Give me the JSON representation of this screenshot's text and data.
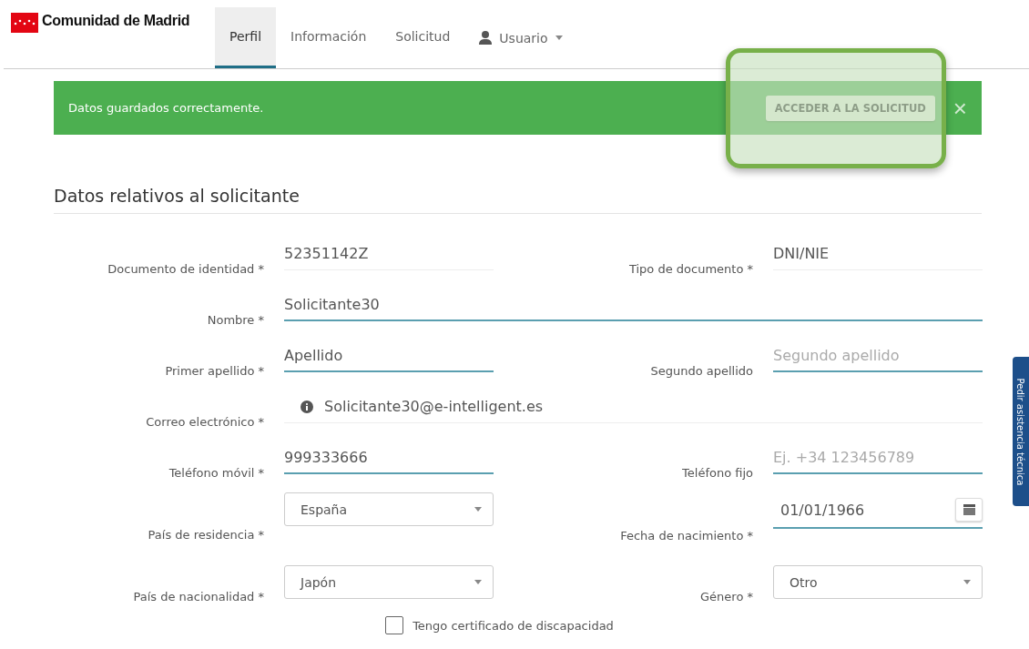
{
  "header": {
    "logo": "Comunidad de Madrid",
    "tabs": [
      {
        "label": "Perfil",
        "selected": true
      },
      {
        "label": "Información",
        "selected": false
      },
      {
        "label": "Solicitud",
        "selected": false
      }
    ],
    "user_menu": "Usuario"
  },
  "alert": {
    "message": "Datos guardados correctamente.",
    "button": "ACCEDER A LA SOLICITUD",
    "close": "×",
    "highlighted": true
  },
  "section_title": "Datos relativos al solicitante",
  "rows": [
    {
      "fields": [
        {
          "kind": "static",
          "label": "Documento de identidad *",
          "value": "52351142Z"
        },
        {
          "kind": "static",
          "label": "Tipo de documento *",
          "value": "DNI/NIE"
        }
      ]
    },
    {
      "fields": [
        {
          "kind": "wide",
          "label": "Nombre *",
          "value": "Solicitante30"
        }
      ]
    },
    {
      "fields": [
        {
          "kind": "input",
          "label": "Primer apellido *",
          "value": "Apellido"
        },
        {
          "kind": "input",
          "label": "Segundo apellido",
          "placeholder": "Segundo apellido"
        }
      ]
    },
    {
      "fields": [
        {
          "kind": "email",
          "label": "Correo electrónico *",
          "value": "Solicitante30@e-intelligent.es"
        }
      ]
    },
    {
      "fields": [
        {
          "kind": "input",
          "label": "Teléfono móvil *",
          "value": "999333666"
        },
        {
          "kind": "input",
          "label": "Teléfono fijo",
          "placeholder": "Ej. +34 123456789"
        }
      ]
    },
    {
      "fields": [
        {
          "kind": "select",
          "label": "País de residencia *",
          "value": "España"
        },
        {
          "kind": "date",
          "label": "Fecha de nacimiento *",
          "value": "01/01/1966"
        }
      ]
    },
    {
      "fields": [
        {
          "kind": "select",
          "label": "País de nacionalidad *",
          "value": "Japón"
        },
        {
          "kind": "select",
          "label": "Género *",
          "value": "Otro"
        }
      ]
    }
  ],
  "checkbox": {
    "label": "Tengo certificado de discapacidad",
    "checked": false
  },
  "side_tab": "Pedir asistencia técnica"
}
